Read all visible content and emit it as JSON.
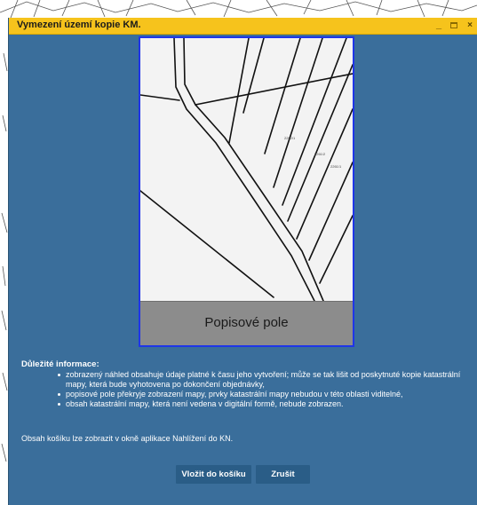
{
  "window": {
    "title": "Vymezení území kopie KM.",
    "min_glyph": "_",
    "close_glyph": "×"
  },
  "preview": {
    "caption": "Popisové pole",
    "parcel_labels": [
      "2262/1",
      "2261/2",
      "2261/1"
    ]
  },
  "info": {
    "heading": "Důležité informace:",
    "items": [
      "zobrazený náhled obsahuje údaje platné k času jeho vytvoření; může se tak lišit od poskytnuté kopie katastrální mapy, která bude vyhotovena po dokončení objednávky,",
      "popisové pole překryje zobrazení mapy, prvky katastrální mapy nebudou v této oblasti viditelné,",
      "obsah katastrální mapy, která není vedena v digitální formě, nebude zobrazen."
    ],
    "cart_note": "Obsah košíku lze zobrazit v okně aplikace Nahlížení do KN."
  },
  "buttons": {
    "insert": "Vložit do košíku",
    "cancel": "Zrušit"
  },
  "colors": {
    "dialog_bg": "#3a6e9b",
    "titlebar": "#f6c31c",
    "preview_border": "#1f35e8",
    "caption_bg": "#8c8c8c",
    "button_bg": "#2a5d87"
  }
}
